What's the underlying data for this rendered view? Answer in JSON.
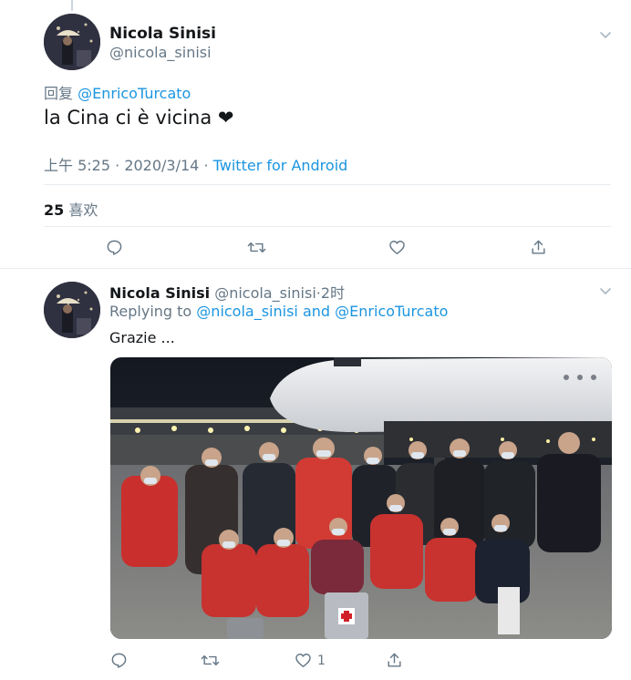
{
  "tweet": {
    "author_name": "Nicola Sinisi",
    "author_handle": "@nicola_sinisi",
    "reply_prefix": "回复",
    "reply_to": "@EnricoTurcato",
    "text": "la Cina ci è vicina",
    "emoji": "❤",
    "time": "上午 5:25",
    "date": "2020/3/14",
    "separator": "·",
    "source": "Twitter for Android",
    "likes_count": "25",
    "likes_label": "喜欢"
  },
  "reply": {
    "author_name": "Nicola Sinisi",
    "author_handle": "@nicola_sinisi",
    "separator": "·",
    "age": "2时",
    "replying_label": "Replying to",
    "replying_to_1": "@nicola_sinisi",
    "replying_and": "and",
    "replying_to_2": "@EnricoTurcato",
    "text": "Grazie ...",
    "like_count": "1"
  },
  "icons": {
    "reply": "reply-icon",
    "retweet": "retweet-icon",
    "like": "heart-icon",
    "share": "share-icon",
    "more": "chevron-down-icon"
  },
  "colors": {
    "link": "#1b95e0",
    "secondary": "#657786",
    "divider": "#e6ecf0"
  }
}
